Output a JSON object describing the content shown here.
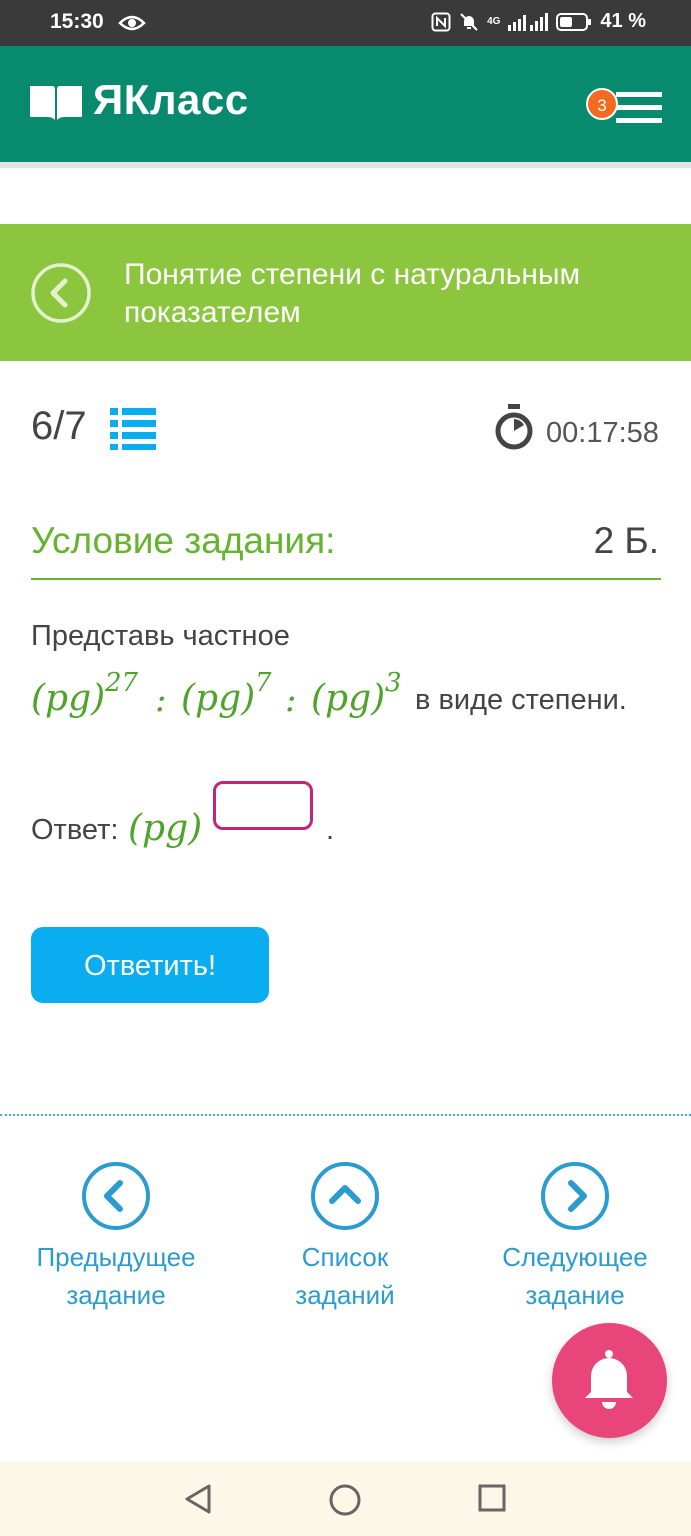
{
  "status_bar": {
    "time": "15:30",
    "battery": "41 %",
    "network_label": "4G"
  },
  "header": {
    "logo": "ЯКласс",
    "notification_count": "3"
  },
  "topic": {
    "title": "Понятие степени с натуральным показателем"
  },
  "progress": {
    "current": "6/7",
    "timer": "00:17:58"
  },
  "task": {
    "condition_label": "Условие задания:",
    "points": "2 Б.",
    "text_prefix": "Представь частное",
    "math": {
      "base": "(pg)",
      "exp1": "27",
      "exp2": "7",
      "exp3": "3",
      "op": ":"
    },
    "text_suffix": "в виде степени."
  },
  "answer": {
    "label": "Ответ:",
    "base": "(pg)",
    "value": "",
    "tail": "."
  },
  "submit_label": "Ответить!",
  "bottom_nav": {
    "prev": [
      "Предыдущее",
      "задание"
    ],
    "list": [
      "Список",
      "заданий"
    ],
    "next": [
      "Следующее",
      "задание"
    ]
  },
  "colors": {
    "header_bg": "#078a6e",
    "topic_bg": "#8cc63f",
    "accent_green": "#65b32e",
    "button_blue": "#0aaef0",
    "link_blue": "#2b9bd0",
    "input_border": "#c2257a",
    "badge_orange": "#f46a20",
    "bell_pink": "#e8457a"
  }
}
